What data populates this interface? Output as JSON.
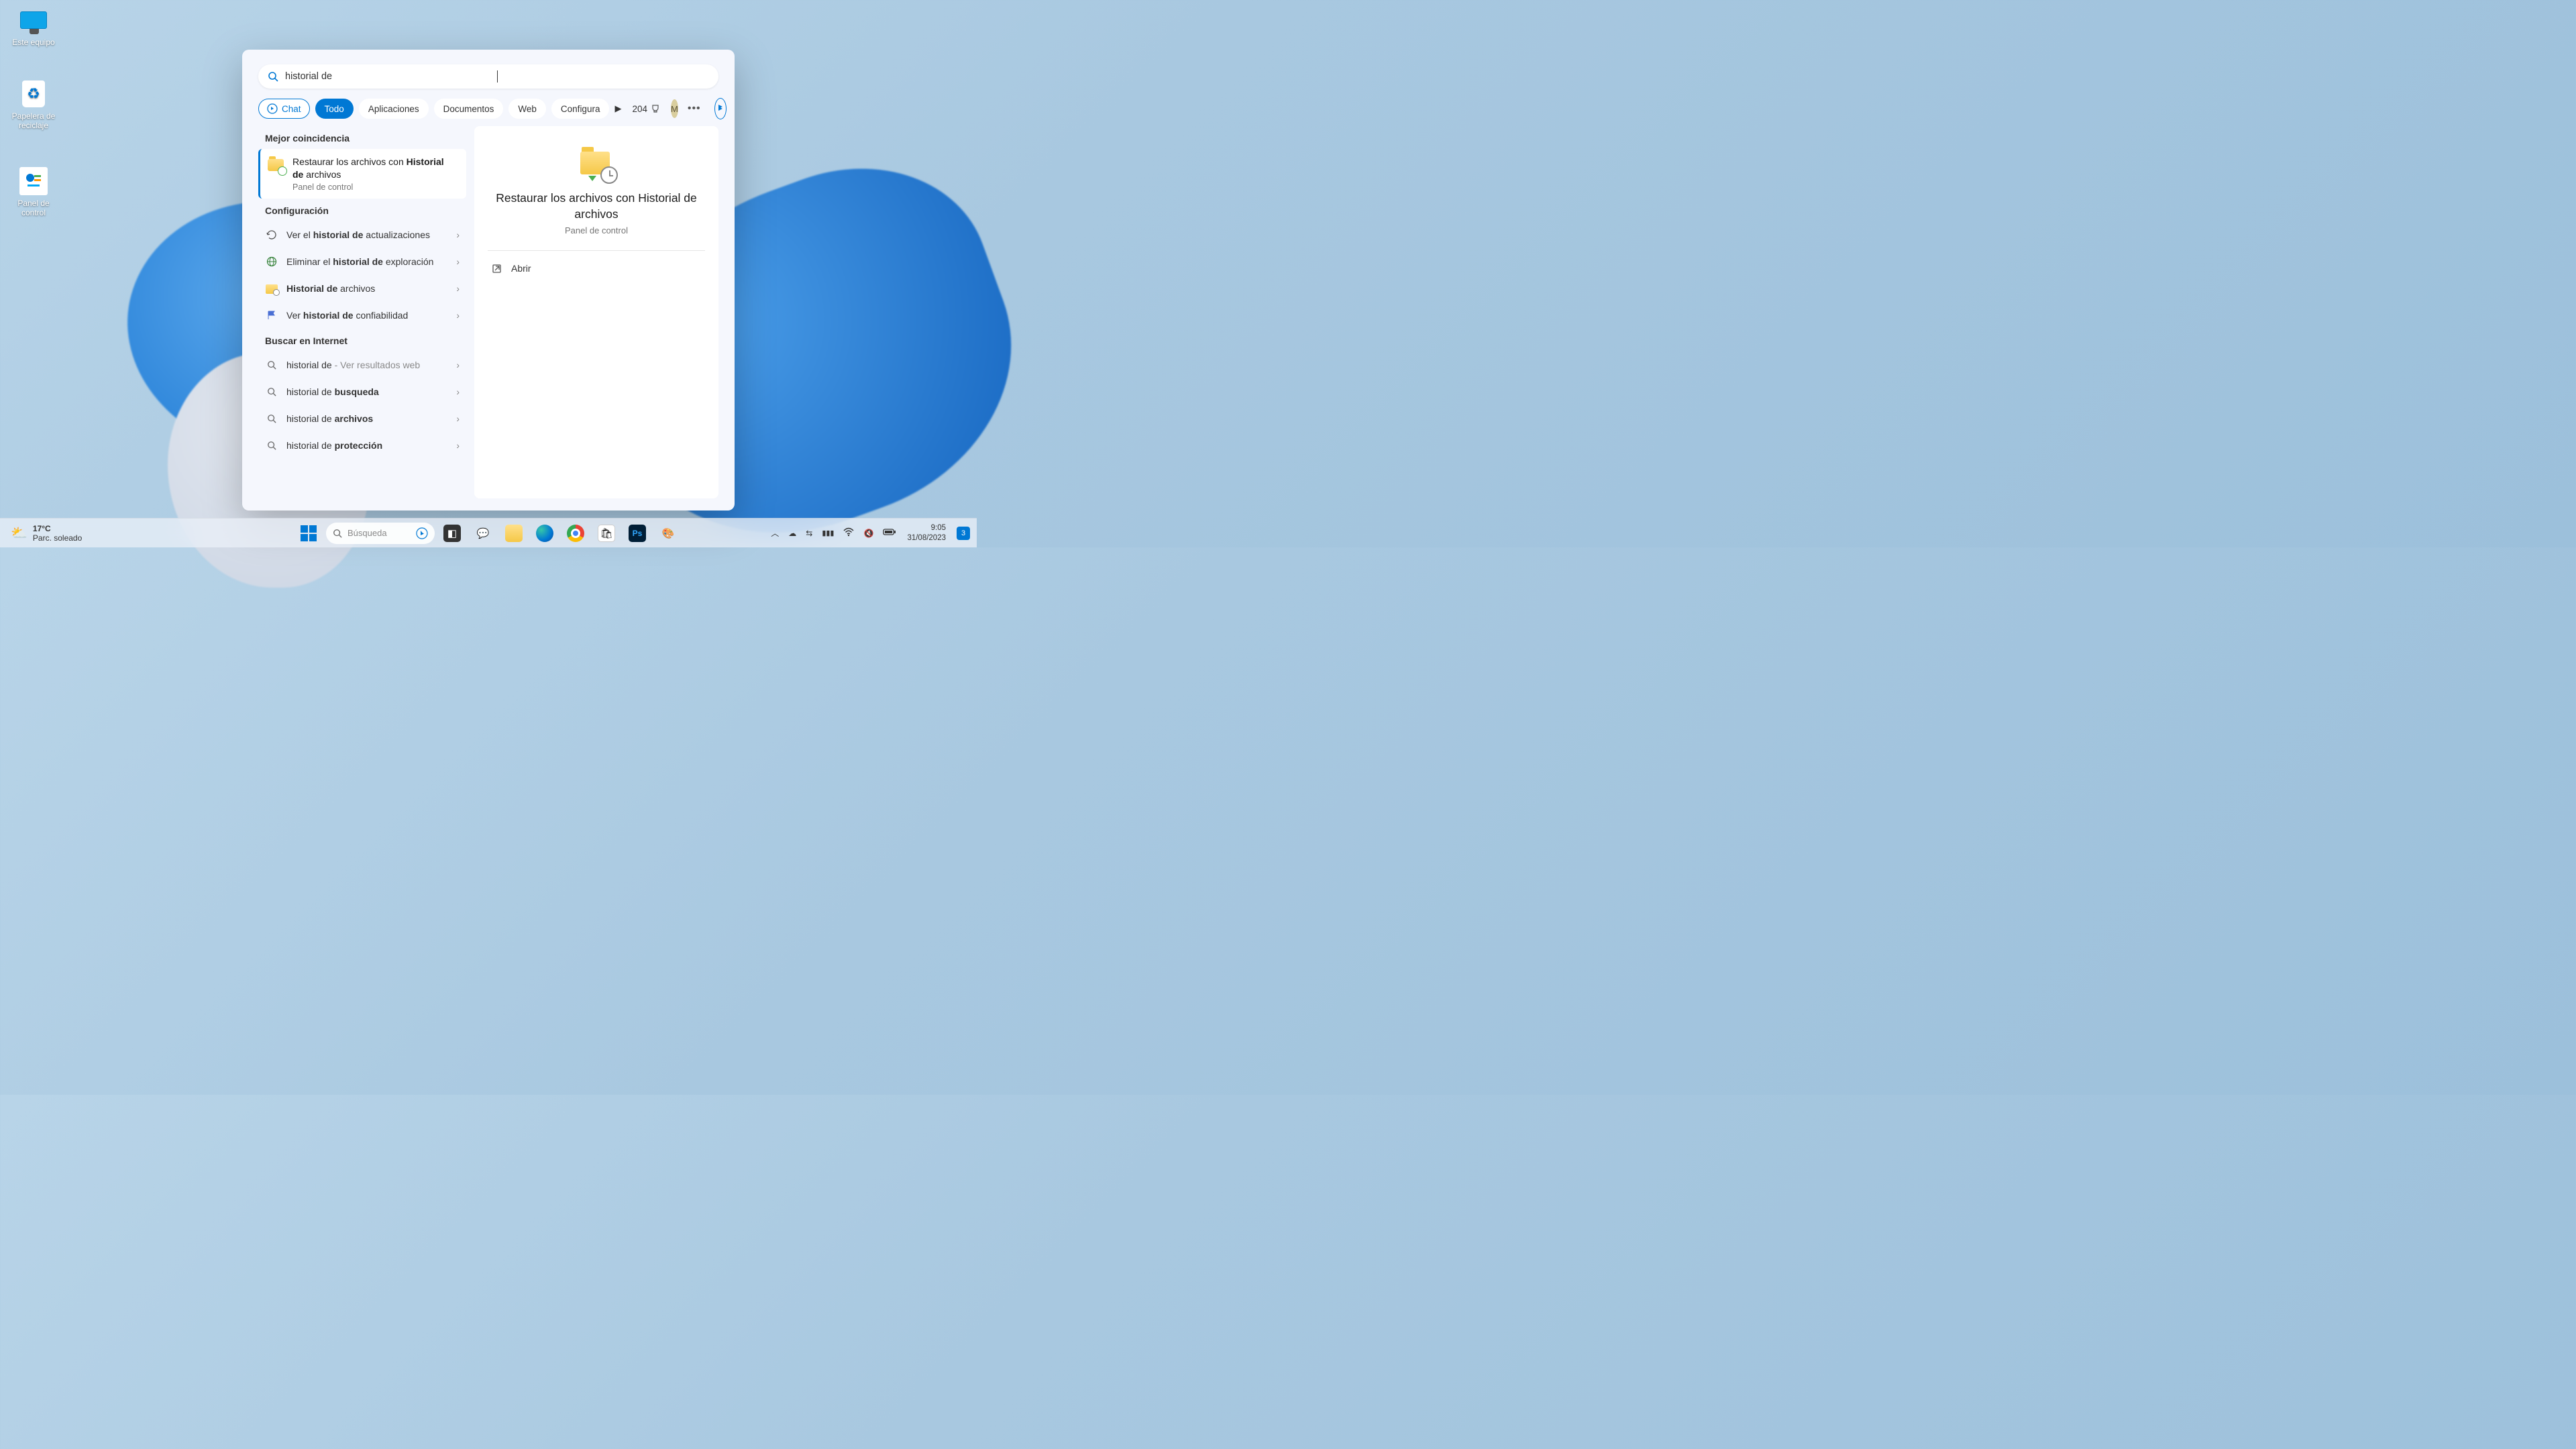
{
  "desktop_icons": {
    "this_pc": "Este equipo",
    "recycle": "Papelera de reciclaje",
    "control_panel": "Panel de control"
  },
  "search": {
    "query": "historial de",
    "filters": {
      "chat": "Chat",
      "all": "Todo",
      "apps": "Aplicaciones",
      "docs": "Documentos",
      "web": "Web",
      "settings": "Configura"
    },
    "rewards_points": "204",
    "user_initial": "M"
  },
  "results": {
    "best_match_header": "Mejor coincidencia",
    "best_match_title_pre": "Restaurar los archivos con ",
    "best_match_title_bold": "Historial de",
    "best_match_title_post": " archivos",
    "best_match_sub": "Panel de control",
    "config_header": "Configuración",
    "cfg1_pre": "Ver el ",
    "cfg1_bold": "historial de",
    "cfg1_post": " actualizaciones",
    "cfg2_pre": "Eliminar el ",
    "cfg2_bold": "historial de",
    "cfg2_post": " exploración",
    "cfg3_bold": "Historial de",
    "cfg3_post": " archivos",
    "cfg4_pre": "Ver ",
    "cfg4_bold": "historial de",
    "cfg4_post": " confiabilidad",
    "web_header": "Buscar en Internet",
    "w1_a": "historial de ",
    "w1_b": "- Ver resultados web",
    "w2_a": "historial de ",
    "w2_b": "busqueda",
    "w3_a": "historial de ",
    "w3_b": "archivos",
    "w4_a": "historial de ",
    "w4_b": "protección"
  },
  "preview": {
    "title": "Restaurar los archivos con Historial de archivos",
    "sub": "Panel de control",
    "open": "Abrir"
  },
  "taskbar": {
    "temp": "17°C",
    "condition": "Parc. soleado",
    "search_placeholder": "Búsqueda",
    "time": "9:05",
    "date": "31/08/2023",
    "notif_count": "3"
  }
}
